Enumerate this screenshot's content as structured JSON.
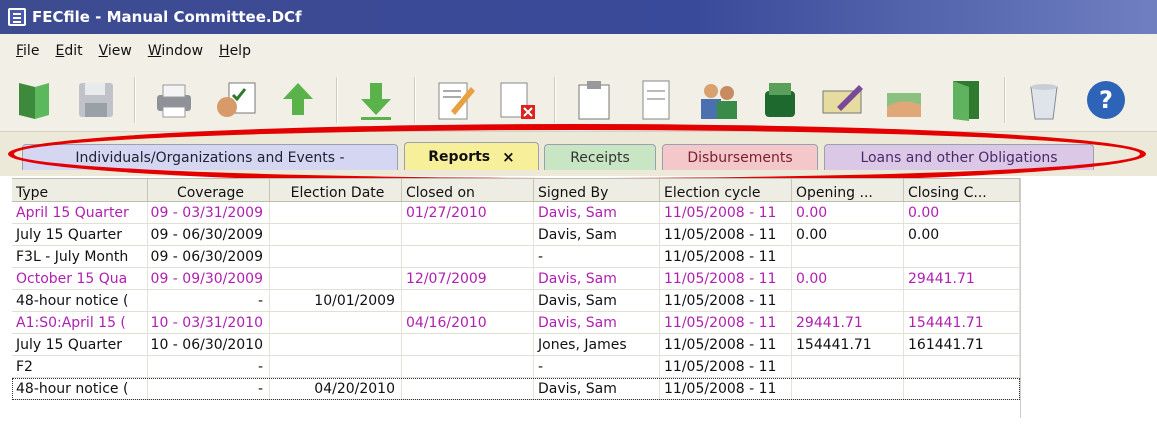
{
  "window": {
    "title": "FECfile - Manual Committee.DCf"
  },
  "menu": [
    "File",
    "Edit",
    "View",
    "Window",
    "Help"
  ],
  "toolbar": [
    {
      "name": "open-book-icon"
    },
    {
      "name": "save-disk-icon"
    },
    {
      "name": "printer-icon"
    },
    {
      "name": "validate-icon"
    },
    {
      "name": "upload-arrow-icon"
    },
    {
      "name": "import-arrow-icon"
    },
    {
      "name": "edit-report-icon"
    },
    {
      "name": "delete-report-icon"
    },
    {
      "name": "clipboard-icon"
    },
    {
      "name": "document-icon"
    },
    {
      "name": "contacts-icon"
    },
    {
      "name": "money-icon"
    },
    {
      "name": "check-icon"
    },
    {
      "name": "loan-icon"
    },
    {
      "name": "exit-door-icon"
    },
    {
      "name": "recycle-bin-icon"
    },
    {
      "name": "help-icon"
    }
  ],
  "tabs": {
    "individuals": "Individuals/Organizations and Events -",
    "reports": "Reports",
    "reports_close": "×",
    "receipts": "Receipts",
    "disbursements": "Disbursements",
    "loans": "Loans and other Obligations"
  },
  "table": {
    "headers": [
      "Type",
      "Coverage",
      "Election Date",
      "Closed on",
      "Signed By",
      "Election cycle",
      "Opening ...",
      "Closing C..."
    ],
    "rows": [
      {
        "style": "pink",
        "cells": [
          "April 15 Quarter",
          "09 - 03/31/2009",
          "",
          "01/27/2010",
          "Davis, Sam",
          "11/05/2008 - 11",
          "0.00",
          "0.00"
        ]
      },
      {
        "style": "",
        "cells": [
          "July 15 Quarter",
          "09 - 06/30/2009",
          "",
          "",
          "Davis, Sam",
          "11/05/2008 - 11",
          "0.00",
          "0.00"
        ]
      },
      {
        "style": "",
        "cells": [
          "F3L - July Month",
          "09 - 06/30/2009",
          "",
          "",
          "-",
          "11/05/2008 - 11",
          "",
          ""
        ]
      },
      {
        "style": "pink",
        "cells": [
          "October 15 Qua",
          "09 - 09/30/2009",
          "",
          "12/07/2009",
          "Davis, Sam",
          "11/05/2008 - 11",
          "0.00",
          "29441.71"
        ]
      },
      {
        "style": "",
        "cells": [
          "48-hour notice (",
          "-",
          "10/01/2009",
          "",
          "Davis, Sam",
          "11/05/2008 - 11",
          "",
          ""
        ]
      },
      {
        "style": "pink",
        "cells": [
          "A1:S0:April 15 (",
          "10 - 03/31/2010",
          "",
          "04/16/2010",
          "Davis, Sam",
          "11/05/2008 - 11",
          "29441.71",
          "154441.71"
        ]
      },
      {
        "style": "",
        "cells": [
          "July 15 Quarter",
          "10 - 06/30/2010",
          "",
          "",
          "Jones, James",
          "11/05/2008 - 11",
          "154441.71",
          "161441.71"
        ]
      },
      {
        "style": "",
        "cells": [
          "F2",
          "-",
          "",
          "",
          "-",
          "11/05/2008 - 11",
          "",
          ""
        ]
      },
      {
        "style": "focused",
        "cells": [
          "48-hour notice (",
          "-",
          "04/20/2010",
          "",
          "Davis, Sam",
          "11/05/2008 - 11",
          "",
          ""
        ]
      }
    ]
  },
  "colors": {
    "titlebar": "#3a4a9a",
    "highlight_oval": "#e40000",
    "amended_text": "#b020b0"
  }
}
